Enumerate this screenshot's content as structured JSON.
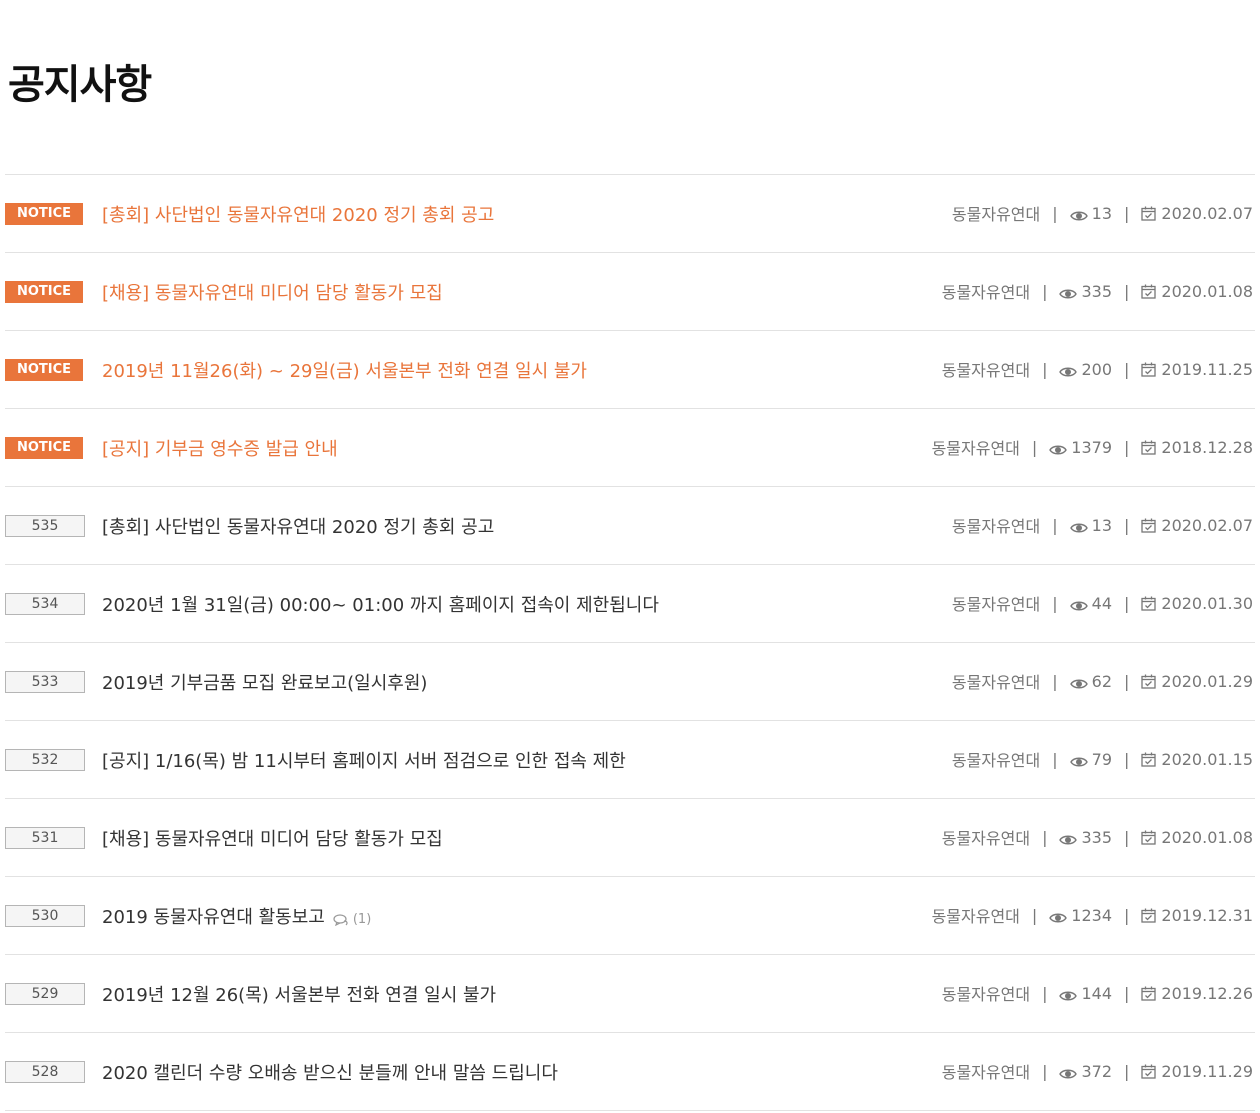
{
  "page": {
    "title": "공지사항"
  },
  "icons": {
    "views": "eye-icon",
    "date": "calendar-icon",
    "comment": "comment-bubble-icon"
  },
  "colors": {
    "notice_accent": "#e9753b"
  },
  "rows": [
    {
      "badge": "NOTICE",
      "notice": true,
      "title": "[총회] 사단법인 동물자유연대 2020 정기 총회 공고",
      "author": "동물자유연대",
      "views": "13",
      "date": "2020.02.07"
    },
    {
      "badge": "NOTICE",
      "notice": true,
      "title": "[채용] 동물자유연대 미디어 담당 활동가 모집",
      "author": "동물자유연대",
      "views": "335",
      "date": "2020.01.08"
    },
    {
      "badge": "NOTICE",
      "notice": true,
      "title": "2019년 11월26(화) ~ 29일(금) 서울본부 전화 연결 일시 불가",
      "author": "동물자유연대",
      "views": "200",
      "date": "2019.11.25"
    },
    {
      "badge": "NOTICE",
      "notice": true,
      "title": "[공지] 기부금 영수증 발급 안내",
      "author": "동물자유연대",
      "views": "1379",
      "date": "2018.12.28"
    },
    {
      "badge": "535",
      "notice": false,
      "title": "[총회] 사단법인 동물자유연대 2020 정기 총회 공고",
      "author": "동물자유연대",
      "views": "13",
      "date": "2020.02.07"
    },
    {
      "badge": "534",
      "notice": false,
      "title": "2020년 1월 31일(금) 00:00~ 01:00 까지 홈페이지 접속이 제한됩니다",
      "author": "동물자유연대",
      "views": "44",
      "date": "2020.01.30"
    },
    {
      "badge": "533",
      "notice": false,
      "title": "2019년 기부금품 모집 완료보고(일시후원)",
      "author": "동물자유연대",
      "views": "62",
      "date": "2020.01.29"
    },
    {
      "badge": "532",
      "notice": false,
      "title": "[공지] 1/16(목) 밤 11시부터 홈페이지 서버 점검으로 인한 접속 제한",
      "author": "동물자유연대",
      "views": "79",
      "date": "2020.01.15"
    },
    {
      "badge": "531",
      "notice": false,
      "title": "[채용] 동물자유연대 미디어 담당 활동가 모집",
      "author": "동물자유연대",
      "views": "335",
      "date": "2020.01.08"
    },
    {
      "badge": "530",
      "notice": false,
      "title": "2019 동물자유연대 활동보고",
      "comments": "(1)",
      "author": "동물자유연대",
      "views": "1234",
      "date": "2019.12.31"
    },
    {
      "badge": "529",
      "notice": false,
      "title": "2019년 12월 26(목) 서울본부 전화 연결 일시 불가",
      "author": "동물자유연대",
      "views": "144",
      "date": "2019.12.26"
    },
    {
      "badge": "528",
      "notice": false,
      "title": "2020 캘린더 수량 오배송 받으신 분들께 안내 말씀 드립니다",
      "author": "동물자유연대",
      "views": "372",
      "date": "2019.11.29"
    }
  ]
}
